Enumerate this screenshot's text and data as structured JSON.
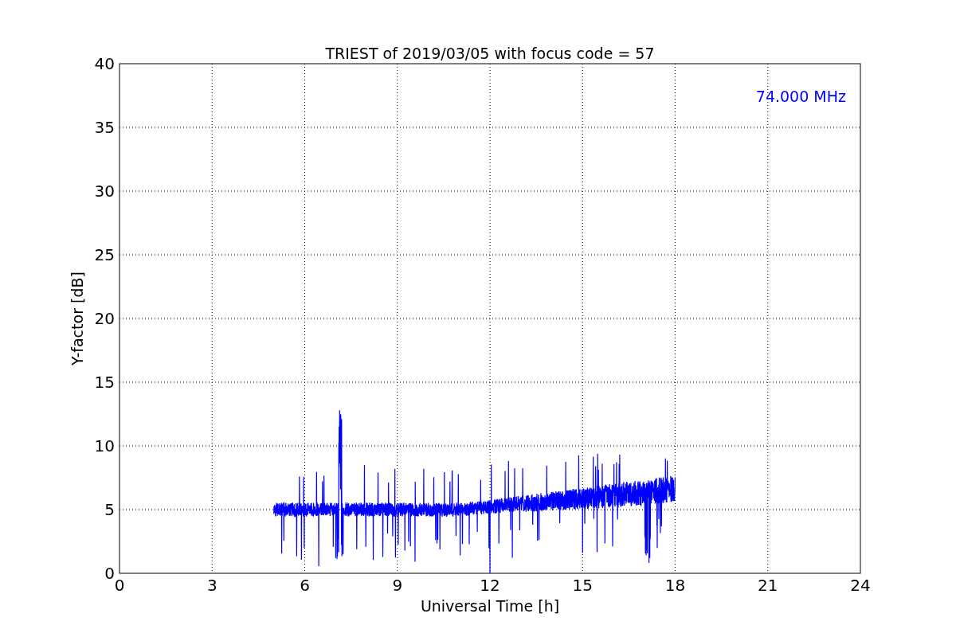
{
  "plot": {
    "title": "TRIEST of 2019/03/05 with focus code = 57",
    "xlabel": "Universal Time [h]",
    "ylabel": "Y-factor [dB]",
    "xticks": [
      "0",
      "3",
      "6",
      "9",
      "12",
      "15",
      "18",
      "21",
      "24"
    ],
    "yticks": [
      "40",
      "35",
      "30",
      "25",
      "20",
      "15",
      "10",
      "5",
      "0"
    ],
    "annotation": "74.000 MHz"
  }
}
